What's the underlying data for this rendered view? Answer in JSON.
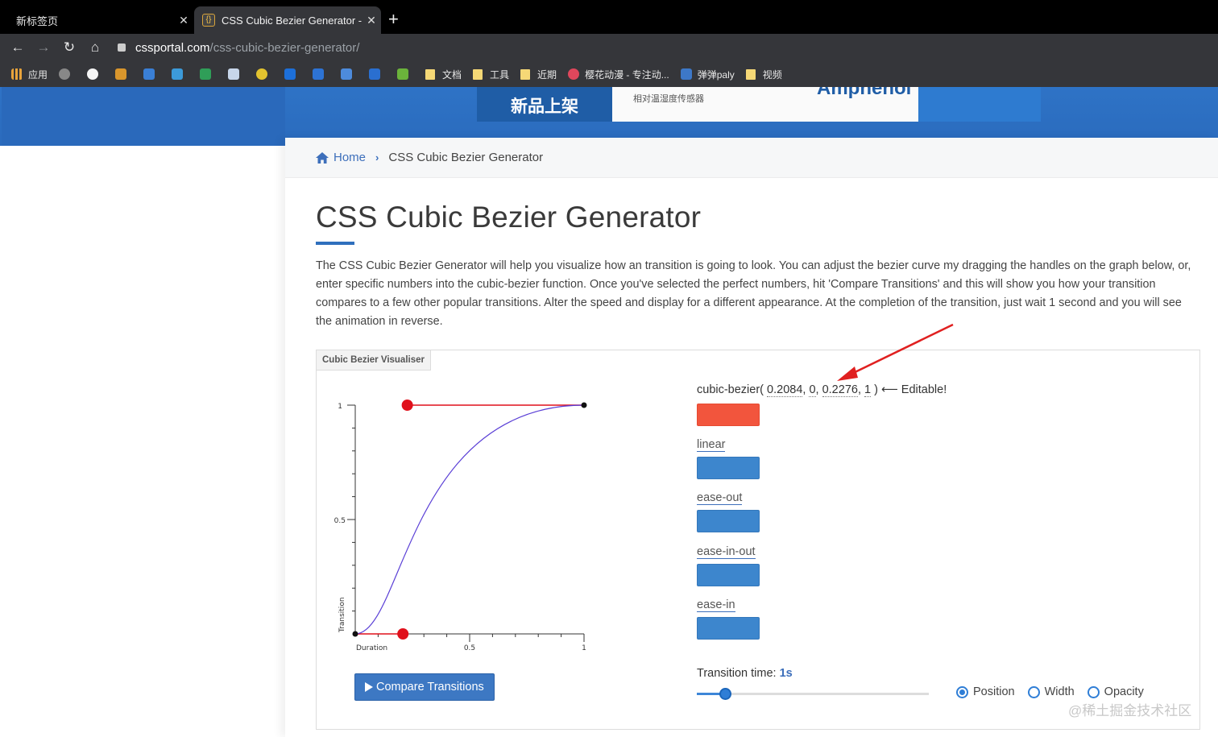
{
  "browser": {
    "tabs": [
      {
        "title": "新标签页",
        "close": "✕"
      },
      {
        "title": "CSS Cubic Bezier Generator - C",
        "close": "✕"
      }
    ],
    "new_tab": "+",
    "url_host": "cssportal.com",
    "url_path": "/css-cubic-bezier-generator/",
    "bookmarks": [
      {
        "label": "应用",
        "icon": "apps-grid-icon"
      },
      {
        "label": "",
        "icon": "bookmark-icon"
      },
      {
        "label": "",
        "icon": "github-icon"
      },
      {
        "label": "文档",
        "icon": "folder-icon"
      },
      {
        "label": "工具",
        "icon": "folder-icon"
      },
      {
        "label": "近期",
        "icon": "folder-icon"
      },
      {
        "label": "樱花动漫 - 专注动...",
        "icon": "sakura-icon"
      },
      {
        "label": "弹弹paly",
        "icon": "dandan-icon"
      },
      {
        "label": "视频",
        "icon": "folder-icon"
      }
    ]
  },
  "ad": {
    "headline": "新品上架",
    "small_text": "相对温湿度传感器",
    "brand": "Amphenol"
  },
  "breadcrumb": {
    "home": "Home",
    "sep": "›",
    "current": "CSS Cubic Bezier Generator"
  },
  "page": {
    "title": "CSS Cubic Bezier Generator",
    "intro": "The CSS Cubic Bezier Generator will help you visualize how an transition is going to look. You can adjust the bezier curve my dragging the handles on the graph below, or, enter specific numbers into the cubic-bezier function. Once you've selected the perfect numbers, hit 'Compare Transitions' and this will show you how your transition compares to a few other popular transitions. Alter the speed and display for a different appearance. At the completion of the transition, just wait 1 second and you will see the animation in reverse."
  },
  "visualiser": {
    "tab_label": "Cubic Bezier Visualiser",
    "formula_prefix": "cubic-bezier(",
    "p1": "0.2084",
    "p2": "0",
    "p3": "0.2276",
    "p4": "1",
    "formula_suffix": ") ⟵ Editable!",
    "comma": ",",
    "graph": {
      "y_ticks": [
        "1",
        "0.5"
      ],
      "x_ticks": [
        "0.5",
        "1"
      ],
      "x_label": "Duration",
      "y_label": "Transition"
    },
    "compare_button": "Compare Transitions",
    "transitions": [
      {
        "label": "linear"
      },
      {
        "label": "ease-out"
      },
      {
        "label": "ease-in-out"
      },
      {
        "label": "ease-in"
      }
    ],
    "colors": {
      "custom": "#f2553d",
      "preset": "#3d86cd",
      "curve": "#5a3fd6",
      "handle": "#e0101b"
    },
    "transition_time_label": "Transition time:",
    "transition_time_value": "1s",
    "slider_fraction": 0.12,
    "display_options": [
      {
        "label": "Position",
        "selected": true
      },
      {
        "label": "Width",
        "selected": false
      },
      {
        "label": "Opacity",
        "selected": false
      }
    ]
  },
  "watermark": "@稀土掘金技术社区"
}
